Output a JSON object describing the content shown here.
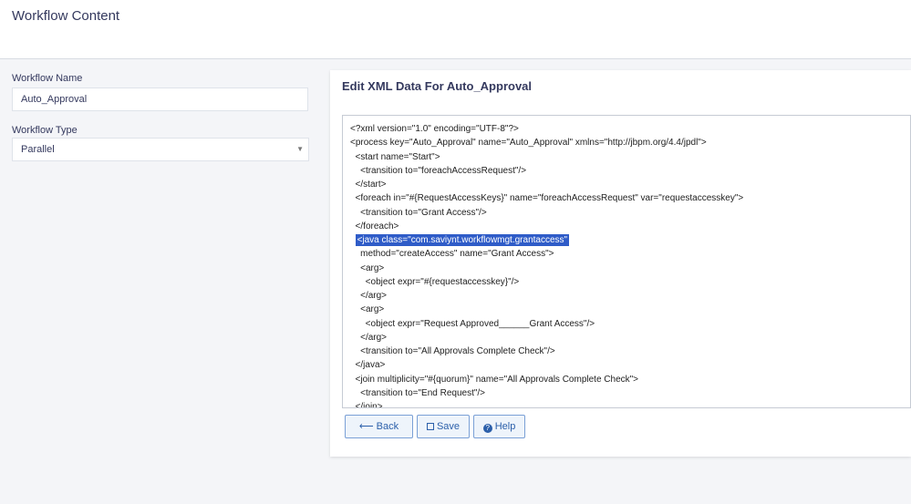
{
  "header": {
    "title": "Workflow Content"
  },
  "form": {
    "name_label": "Workflow Name",
    "name_value": "Auto_Approval",
    "type_label": "Workflow Type",
    "type_value": "Parallel"
  },
  "editor": {
    "title": "Edit XML Data For Auto_Approval",
    "lines": [
      "<?xml version=\"1.0\" encoding=\"UTF-8\"?>",
      "<process key=\"Auto_Approval\" name=\"Auto_Approval\" xmlns=\"http://jbpm.org/4.4/jpdl\">",
      "  <start name=\"Start\">",
      "    <transition to=\"foreachAccessRequest\"/>",
      "  </start>",
      "  <foreach in=\"#{RequestAccessKeys}\" name=\"foreachAccessRequest\" var=\"requestaccesskey\">",
      "    <transition to=\"Grant Access\"/>",
      "  </foreach>",
      "  <java class=\"com.saviynt.workflowmgt.grantaccess\"",
      "    method=\"createAccess\" name=\"Grant Access\">",
      "    <arg>",
      "      <object expr=\"#{requestaccesskey}\"/>",
      "    </arg>",
      "    <arg>",
      "      <object expr=\"Request Approved______Grant Access\"/>",
      "    </arg>",
      "    <transition to=\"All Approvals Complete Check\"/>",
      "  </java>",
      "  <join multiplicity=\"#{quorum}\" name=\"All Approvals Complete Check\">",
      "    <transition to=\"End Request\"/>",
      "  </join>"
    ],
    "selected_line_index": 8
  },
  "buttons": {
    "back_label": "Back",
    "save_label": "Save",
    "help_label": "Help"
  },
  "colors": {
    "accent": "#2b5faa",
    "selection": "#2f5cc8"
  }
}
